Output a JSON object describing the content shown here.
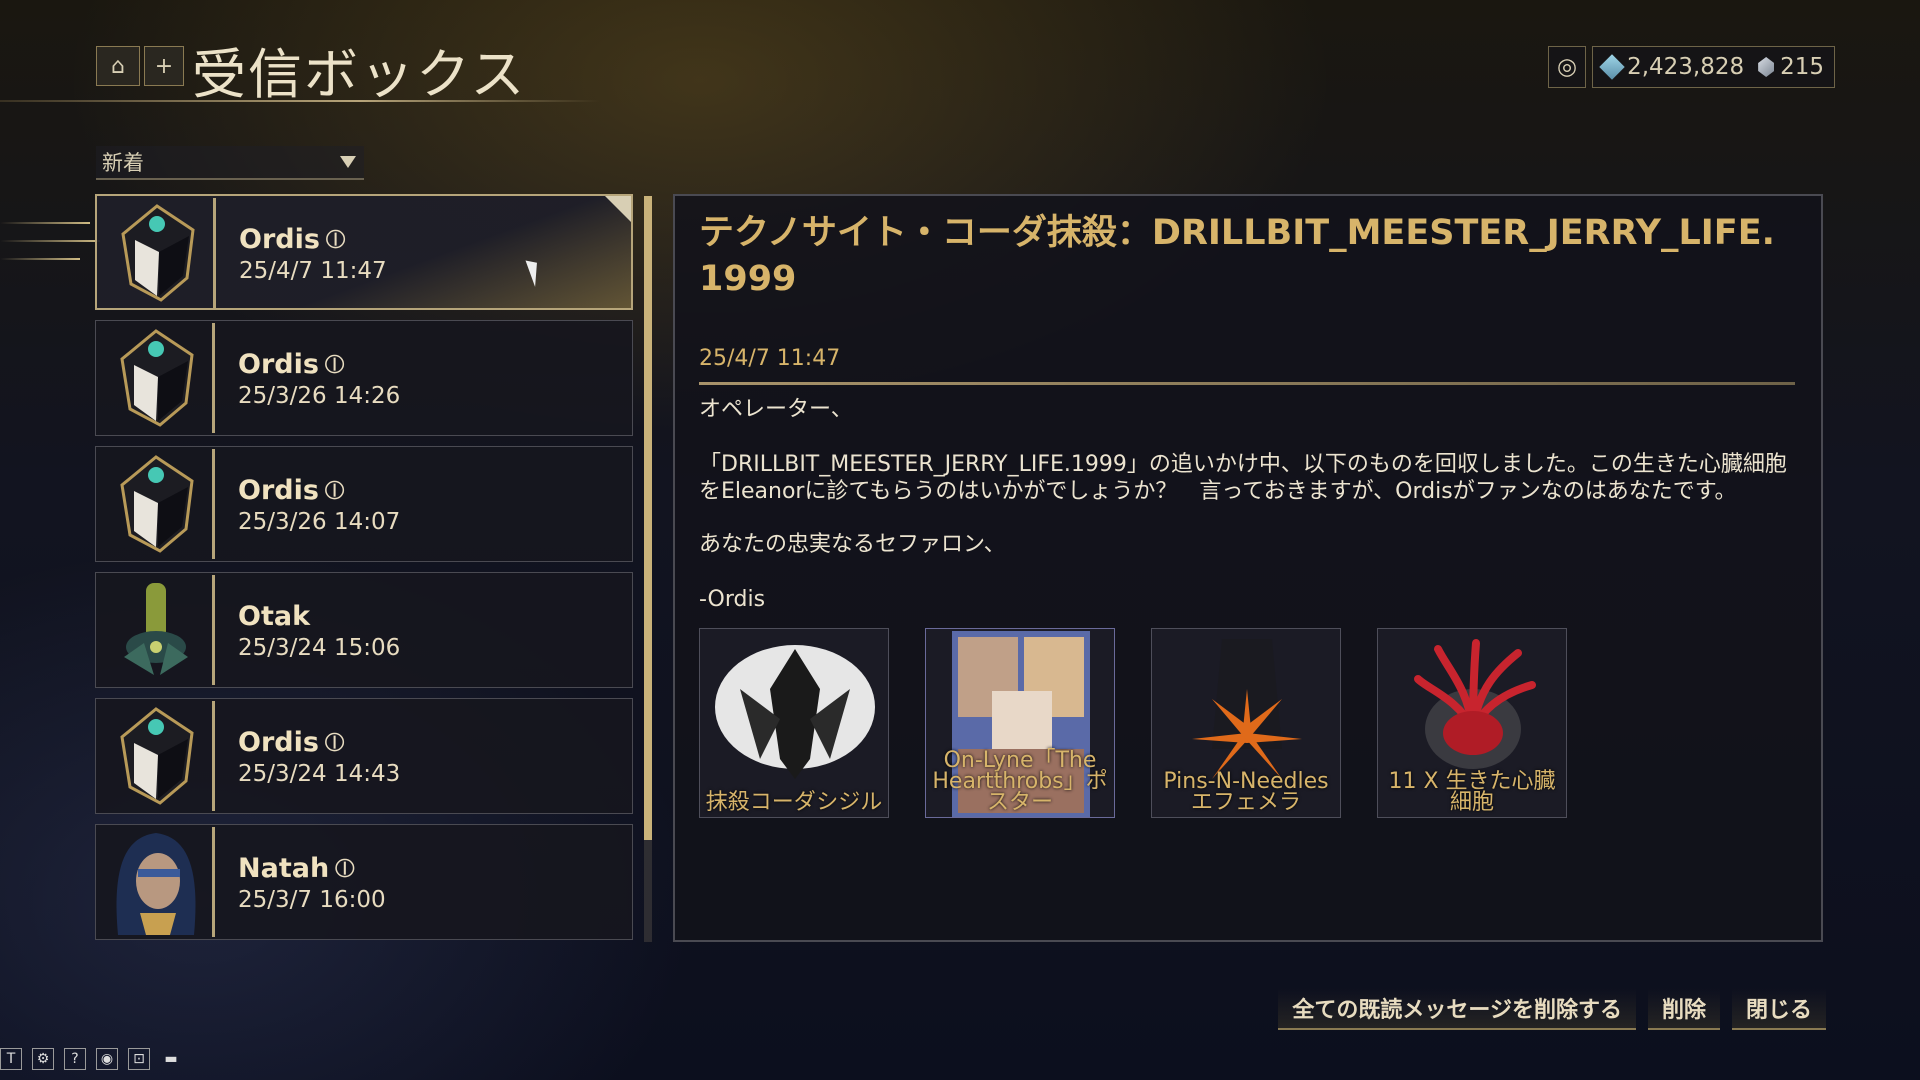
{
  "header": {
    "title": "受信ボックス",
    "plus_label": "+",
    "credits": "2,423,828",
    "platinum": "215"
  },
  "sort": {
    "selected": "新着"
  },
  "messages": [
    {
      "name": "Ordis",
      "date": "25/4/7 11:47",
      "attachment": true,
      "selected": true
    },
    {
      "name": "Ordis",
      "date": "25/3/26 14:26",
      "attachment": true
    },
    {
      "name": "Ordis",
      "date": "25/3/26 14:07",
      "attachment": true
    },
    {
      "name": "Otak",
      "date": "25/3/24 15:06",
      "attachment": false
    },
    {
      "name": "Ordis",
      "date": "25/3/24 14:43",
      "attachment": true
    },
    {
      "name": "Natah",
      "date": "25/3/7 16:00",
      "attachment": true
    }
  ],
  "detail": {
    "title": "テクノサイト・コーダ抹殺：DRILLBIT_MEESTER_JERRY_LIFE.1999",
    "date": "25/4/7 11:47",
    "greeting": "オペレーター、",
    "body": "「DRILLBIT_MEESTER_JERRY_LIFE.1999」の追いかけ中、以下のものを回収しました。この生きた心臓細胞をEleanorに診てもらうのはいかがでしょうか？　言っておきますが、Ordisがファンなのはあなたです。",
    "closing": "あなたの忠実なるセファロン、",
    "signature": "-Ordis",
    "rewards": [
      {
        "label": "抹殺コーダシジル",
        "icon": "sigil-icon"
      },
      {
        "label": "On-Lyne「The Heartthrobs」ポスター",
        "icon": "poster-icon"
      },
      {
        "label": "Pins-N-Needles エフェメラ",
        "icon": "ephemera-icon"
      },
      {
        "label": "11 X 生きた心臓細胞",
        "icon": "heart-cells-icon"
      }
    ]
  },
  "buttons": {
    "delete_all_read": "全ての既読メッセージを削除する",
    "delete": "削除",
    "close": "閉じる"
  },
  "footer": {
    "icons": [
      "T",
      "⚙",
      "?",
      "◉",
      "⊡",
      "▬"
    ]
  }
}
